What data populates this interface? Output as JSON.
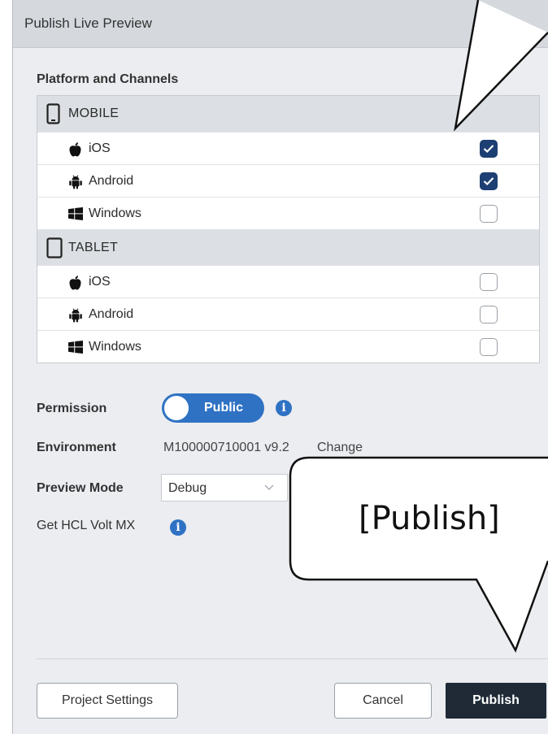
{
  "dialog": {
    "title": "Publish Live Preview"
  },
  "platforms": {
    "section_title": "Platform and Channels",
    "groups": [
      {
        "name": "MOBILE",
        "icon": "mobile-phone-icon",
        "options": [
          {
            "label": "iOS",
            "icon": "apple-icon",
            "checked": true
          },
          {
            "label": "Android",
            "icon": "android-icon",
            "checked": true
          },
          {
            "label": "Windows",
            "icon": "windows-icon",
            "checked": false
          }
        ]
      },
      {
        "name": "TABLET",
        "icon": "tablet-icon",
        "options": [
          {
            "label": "iOS",
            "icon": "apple-icon",
            "checked": false
          },
          {
            "label": "Android",
            "icon": "android-icon",
            "checked": false
          },
          {
            "label": "Windows",
            "icon": "windows-icon",
            "checked": false
          }
        ]
      }
    ]
  },
  "permission": {
    "label": "Permission",
    "toggle_label": "Public",
    "toggle_on": true
  },
  "environment": {
    "label": "Environment",
    "value": "M100000710001 v9.2",
    "change_link": "Change"
  },
  "preview_mode": {
    "label": "Preview Mode",
    "selected": "Debug"
  },
  "get_volt": {
    "label": "Get HCL Volt MX"
  },
  "footer": {
    "project_settings": "Project Settings",
    "cancel": "Cancel",
    "publish": "Publish"
  },
  "callout": {
    "text": "[Publish]"
  },
  "colors": {
    "accent": "#2f72c4",
    "checkbox": "#1e3f73",
    "primary_button": "#1f2a36"
  }
}
